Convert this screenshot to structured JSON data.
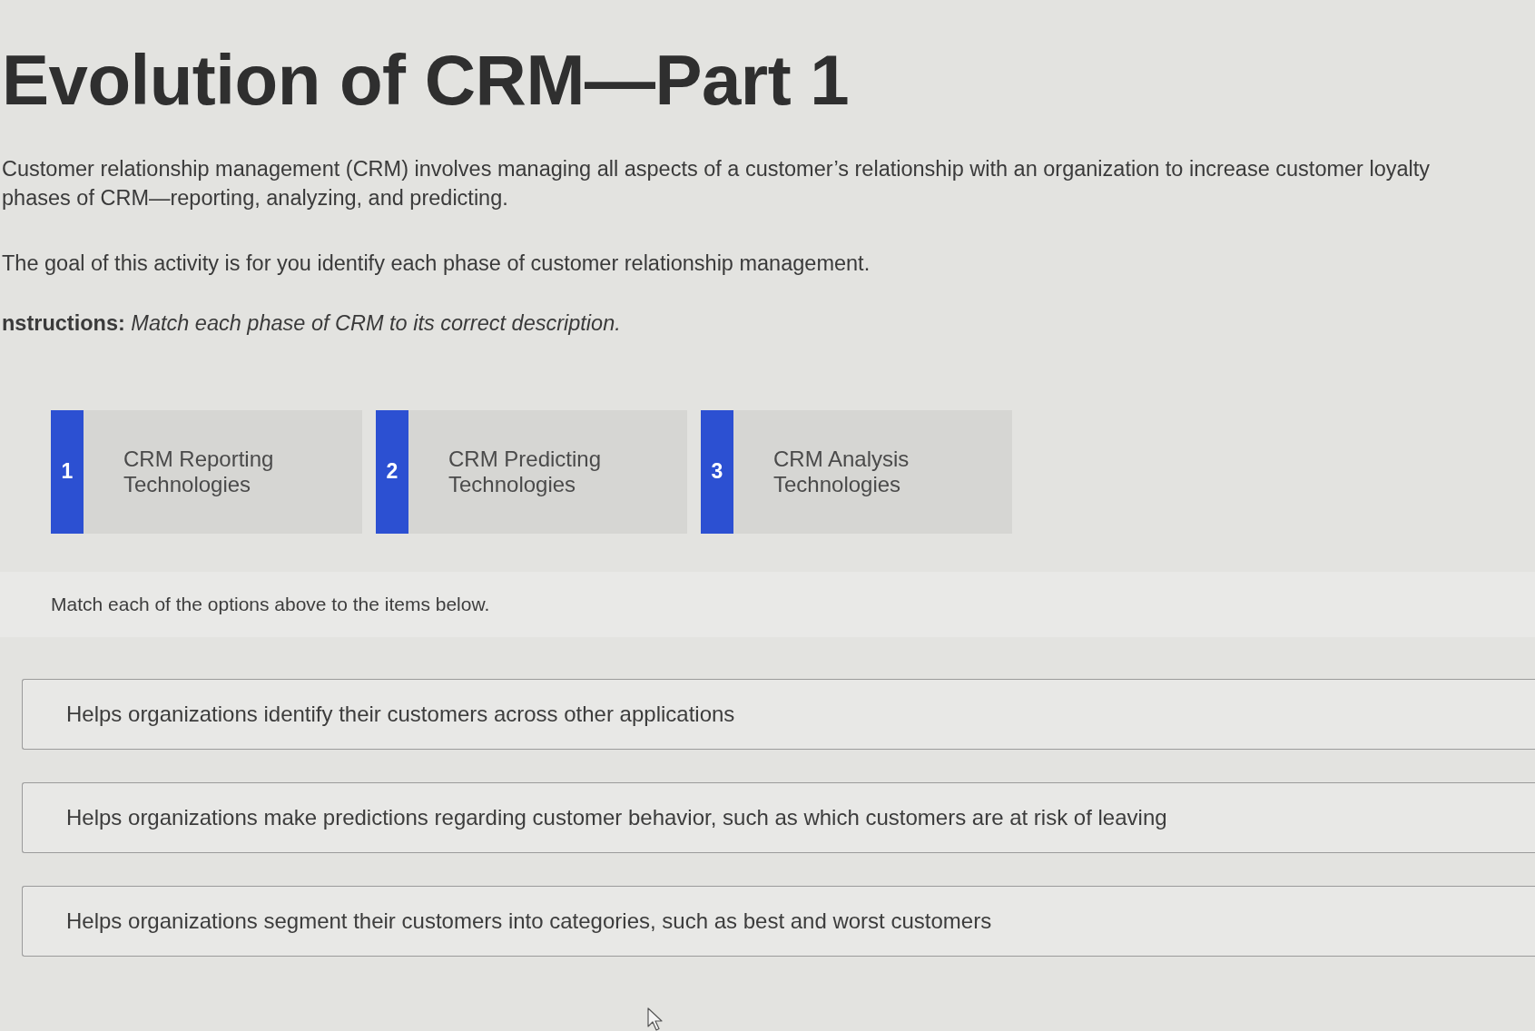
{
  "title": "Evolution of CRM—Part 1",
  "intro_lines": [
    "Customer relationship management (CRM) involves managing all aspects of a customer’s relationship with an organization to increase customer loyalty",
    "phases of CRM—reporting, analyzing, and predicting."
  ],
  "goal": "The goal of this activity is for you identify each phase of customer relationship management.",
  "instructions": "**nstructions:** *Match each phase of CRM to its correct description.*",
  "options": [
    {
      "number": "1",
      "label": "CRM Reporting Technologies"
    },
    {
      "number": "2",
      "label": "CRM Predicting Technologies"
    },
    {
      "number": "3",
      "label": "CRM Analysis Technologies"
    }
  ],
  "match_prompt": "Match each of the options above to the items below.",
  "items": [
    "Helps organizations identify their customers across other applications",
    "Helps organizations make predictions regarding customer behavior, such as which customers are at risk of leaving",
    "Helps organizations segment their customers into categories, such as best and worst customers"
  ]
}
